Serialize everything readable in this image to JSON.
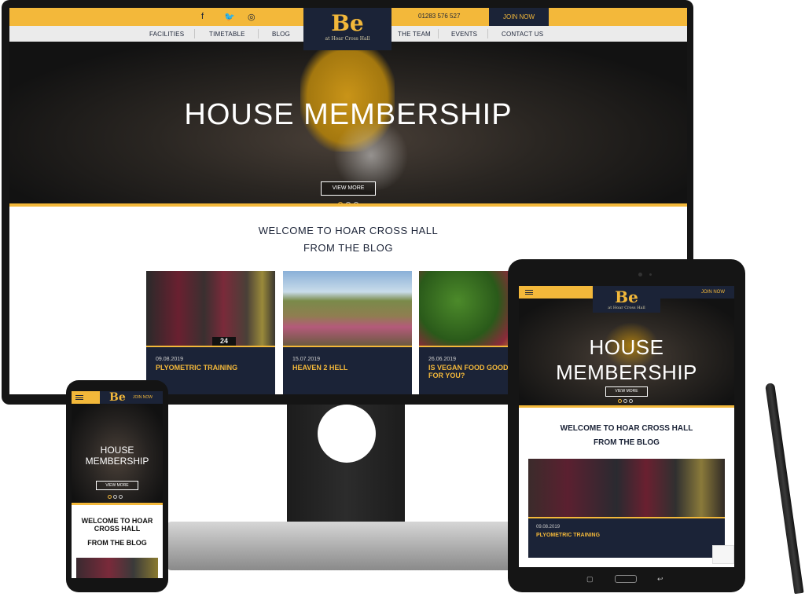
{
  "desktop": {
    "social_icons": [
      "facebook-icon",
      "twitter-icon",
      "instagram-icon"
    ],
    "social_glyphs": [
      "f",
      "🐦",
      "◎"
    ],
    "phone": "01283 576 527",
    "join": "JOIN NOW",
    "nav": [
      "FACILITIES",
      "TIMETABLE",
      "BLOG",
      "THE TEAM",
      "EVENTS",
      "CONTACT US"
    ],
    "logo_mark": "Be",
    "logo_sub": "at Hoar Cross Hall",
    "hero_title": "HOUSE MEMBERSHIP",
    "hero_button": "VIEW MORE",
    "welcome": "WELCOME TO HOAR CROSS HALL",
    "from_blog": "FROM THE BLOG",
    "posts": [
      {
        "date": "09.08.2019",
        "title": "PLYOMETRIC TRAINING"
      },
      {
        "date": "15.07.2019",
        "title": "HEAVEN 2 HELL"
      },
      {
        "date": "26.06.2019",
        "title": "IS VEGAN FOOD GOOD FOR YOU?"
      }
    ],
    "box_number": "24"
  },
  "phone": {
    "logo_mark": "Be",
    "join": "JOIN NOW",
    "hero_title": "HOUSE MEMBERSHIP",
    "hero_button": "VIEW MORE",
    "welcome": "WELCOME TO HOAR CROSS HALL",
    "from_blog": "FROM THE BLOG"
  },
  "tablet": {
    "logo_mark": "Be",
    "logo_sub": "at Hoar Cross Hall",
    "join": "JOIN NOW",
    "hero_title": "HOUSE MEMBERSHIP",
    "hero_button": "VIEW MORE",
    "welcome": "WELCOME TO HOAR CROSS HALL",
    "from_blog": "FROM THE BLOG",
    "post": {
      "date": "09.08.2019",
      "title": "PLYOMETRIC TRAINING"
    }
  },
  "colors": {
    "navy": "#1b2337",
    "gold": "#f3b83a",
    "light_grey": "#ebebeb"
  }
}
